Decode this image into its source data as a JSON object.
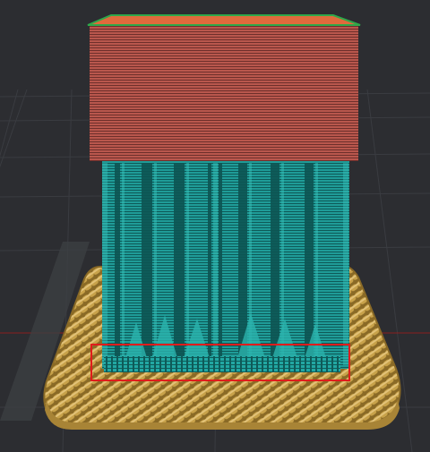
{
  "viewport": {
    "background": "#2c2d31",
    "grid_color": "#3a3c41",
    "x_axis_color": "#8a2020"
  },
  "preview": {
    "raft_color": "#c8a24a",
    "raft_dark": "#8a6a26",
    "support_color": "#1f9c98",
    "support_dark": "#0e5a58",
    "model_color": "#b9574d",
    "model_dark": "#6e2f2b",
    "top_surface_color": "#e06a3c",
    "top_edge_color": "#2fa84a",
    "highlight_box_color": "#e01c1c"
  }
}
